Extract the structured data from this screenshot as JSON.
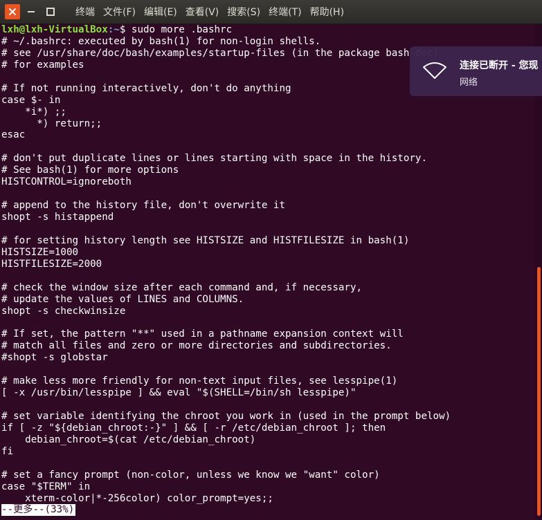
{
  "window": {
    "title": "终端",
    "menu": [
      "文件(F)",
      "编辑(E)",
      "查看(V)",
      "搜索(S)",
      "终端(T)",
      "帮助(H)"
    ]
  },
  "terminal": {
    "prompt_user_host": "lxh@lxh-VirtualBox",
    "prompt_path": ":~",
    "prompt_command": "$ sudo more .bashrc",
    "lines": [
      "# ~/.bashrc: executed by bash(1) for non-login shells.",
      "# see /usr/share/doc/bash/examples/startup-files (in the package bash-doc)",
      "# for examples",
      "",
      "# If not running interactively, don't do anything",
      "case $- in",
      "    *i*) ;;",
      "      *) return;;",
      "esac",
      "",
      "# don't put duplicate lines or lines starting with space in the history.",
      "# See bash(1) for more options",
      "HISTCONTROL=ignoreboth",
      "",
      "# append to the history file, don't overwrite it",
      "shopt -s histappend",
      "",
      "# for setting history length see HISTSIZE and HISTFILESIZE in bash(1)",
      "HISTSIZE=1000",
      "HISTFILESIZE=2000",
      "",
      "# check the window size after each command and, if necessary,",
      "# update the values of LINES and COLUMNS.",
      "shopt -s checkwinsize",
      "",
      "# If set, the pattern \"**\" used in a pathname expansion context will",
      "# match all files and zero or more directories and subdirectories.",
      "#shopt -s globstar",
      "",
      "# make less more friendly for non-text input files, see lesspipe(1)",
      "[ -x /usr/bin/lesspipe ] && eval \"$(SHELL=/bin/sh lesspipe)\"",
      "",
      "# set variable identifying the chroot you work in (used in the prompt below)",
      "if [ -z \"${debian_chroot:-}\" ] && [ -r /etc/debian_chroot ]; then",
      "    debian_chroot=$(cat /etc/debian_chroot)",
      "fi",
      "",
      "# set a fancy prompt (non-color, unless we know we \"want\" color)",
      "case \"$TERM\" in",
      "    xterm-color|*-256color) color_prompt=yes;;"
    ],
    "pager_status": "--更多--(33%)"
  },
  "notification": {
    "title": "连接已断开 - 您现",
    "body": "网络",
    "icon": "wifi-icon"
  },
  "colors": {
    "terminal_bg": "#300a24",
    "close_button": "#e95420",
    "prompt_user": "#8ae234",
    "prompt_path": "#729fcf",
    "scroll_thumb": "#e95420"
  }
}
